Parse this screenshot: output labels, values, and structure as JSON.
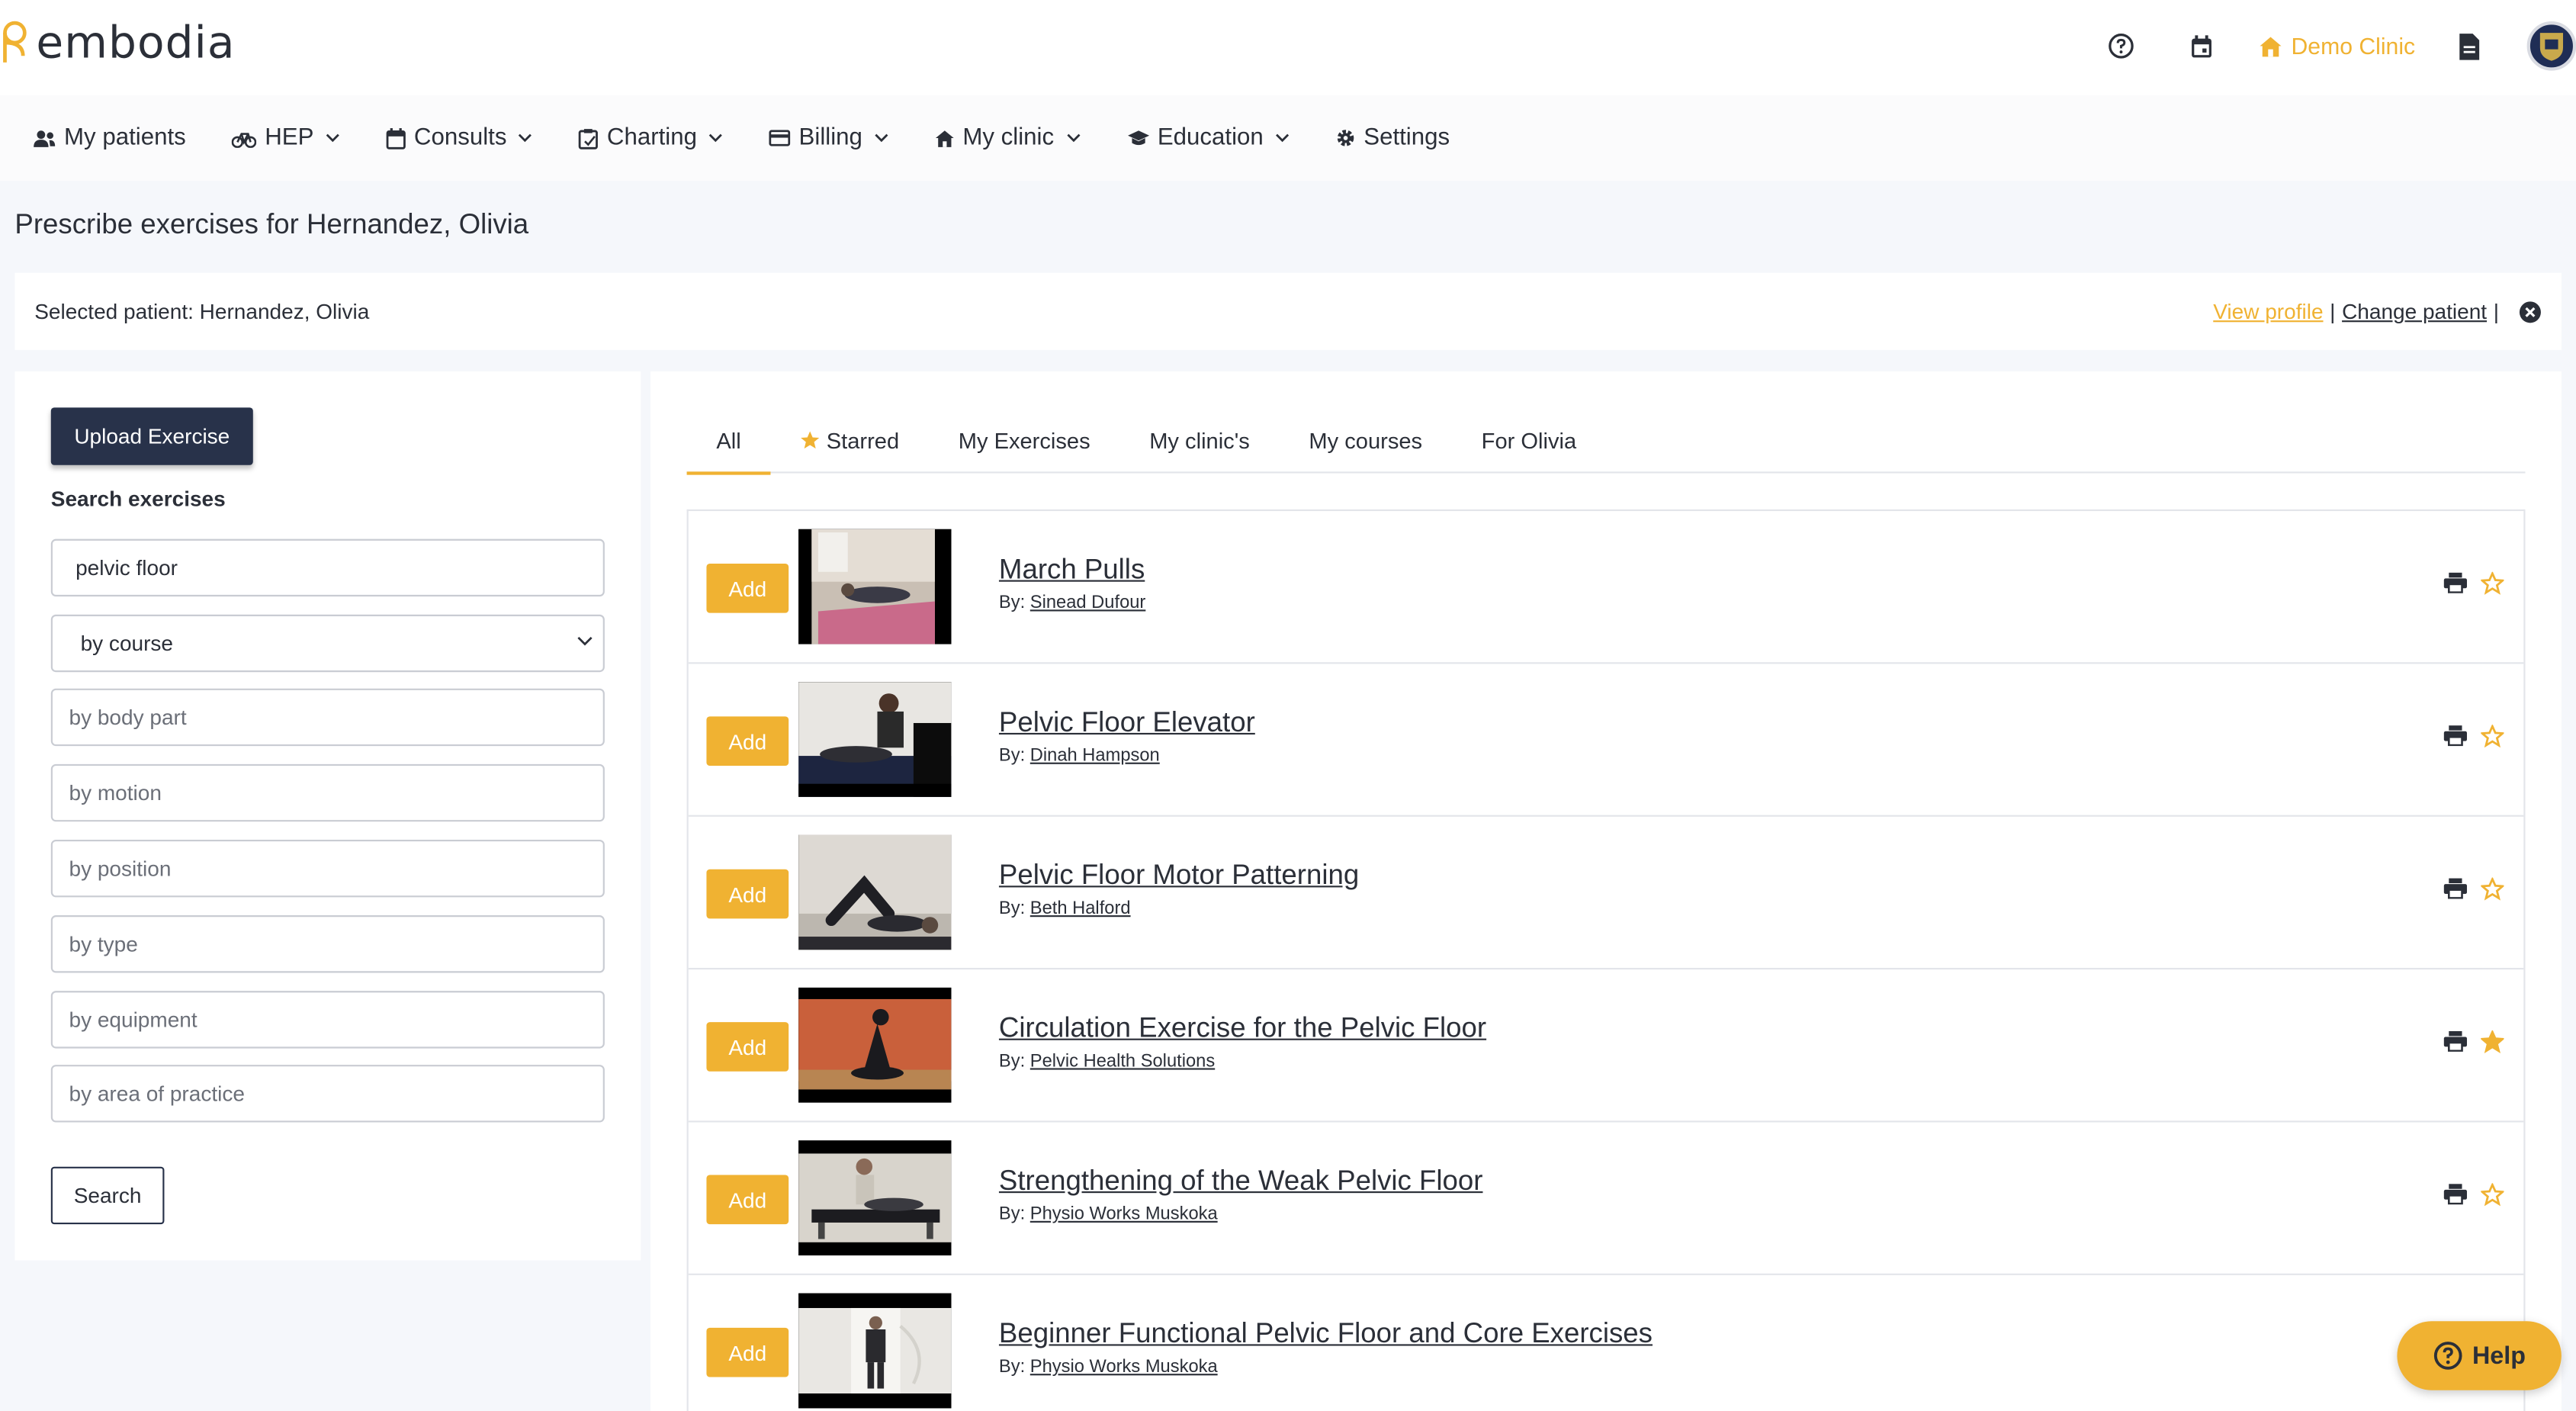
{
  "brand": {
    "name": "embodia",
    "accent": "#f0b232",
    "dark": "#28324a"
  },
  "header": {
    "clinic_label": "Demo Clinic",
    "icons": [
      "help-circle-icon",
      "calendar-icon",
      "clinic-icon",
      "document-icon",
      "avatar"
    ]
  },
  "nav": {
    "items": [
      {
        "label": "My patients",
        "icon": "patients-icon",
        "dropdown": false
      },
      {
        "label": "HEP",
        "icon": "bike-icon",
        "dropdown": true
      },
      {
        "label": "Consults",
        "icon": "calendar-icon",
        "dropdown": true
      },
      {
        "label": "Charting",
        "icon": "clipboard-icon",
        "dropdown": true
      },
      {
        "label": "Billing",
        "icon": "card-icon",
        "dropdown": true
      },
      {
        "label": "My clinic",
        "icon": "clinic-icon",
        "dropdown": true
      },
      {
        "label": "Education",
        "icon": "graduation-cap-icon",
        "dropdown": true
      },
      {
        "label": "Settings",
        "icon": "gear-icon",
        "dropdown": false
      }
    ]
  },
  "page": {
    "title": "Prescribe exercises for Hernandez, Olivia"
  },
  "patient_bar": {
    "selected_text": "Selected patient: Hernandez, Olivia",
    "view_profile": "View profile",
    "separator": "|",
    "change_patient": "Change patient"
  },
  "search": {
    "upload_label": "Upload Exercise",
    "heading": "Search exercises",
    "query_value": "pelvic floor",
    "course_selected": "by course",
    "placeholders": {
      "body_part": "by body part",
      "motion": "by motion",
      "position": "by position",
      "type": "by type",
      "equipment": "by equipment",
      "area": "by area of practice"
    },
    "search_label": "Search"
  },
  "tabs": [
    {
      "label": "All",
      "active": true
    },
    {
      "label": "Starred",
      "active": false,
      "icon": "star-icon"
    },
    {
      "label": "My Exercises",
      "active": false
    },
    {
      "label": "My clinic's",
      "active": false
    },
    {
      "label": "My courses",
      "active": false
    },
    {
      "label": "For Olivia",
      "active": false
    }
  ],
  "exercises": [
    {
      "add": "Add",
      "title": "March Pulls",
      "by": "By:",
      "author": "Sinead Dufour",
      "starred": false,
      "thumb": "pink-mat"
    },
    {
      "add": "Add",
      "title": "Pelvic Floor Elevator",
      "by": "By:",
      "author": "Dinah Hampson",
      "starred": false,
      "thumb": "dark-mat"
    },
    {
      "add": "Add",
      "title": "Pelvic Floor Motor Patterning",
      "by": "By:",
      "author": "Beth Halford",
      "starred": false,
      "thumb": "light-floor"
    },
    {
      "add": "Add",
      "title": "Circulation Exercise for the Pelvic Floor",
      "by": "By:",
      "author": "Pelvic Health Solutions",
      "starred": true,
      "thumb": "orange-wall"
    },
    {
      "add": "Add",
      "title": "Strengthening of the Weak Pelvic Floor",
      "by": "By:",
      "author": "Physio Works Muskoka",
      "starred": false,
      "thumb": "table"
    },
    {
      "add": "Add",
      "title": "Beginner Functional Pelvic Floor and Core Exercises",
      "by": "By:",
      "author": "Physio Works Muskoka",
      "starred": false,
      "thumb": "standing"
    }
  ],
  "help": {
    "label": "Help"
  }
}
